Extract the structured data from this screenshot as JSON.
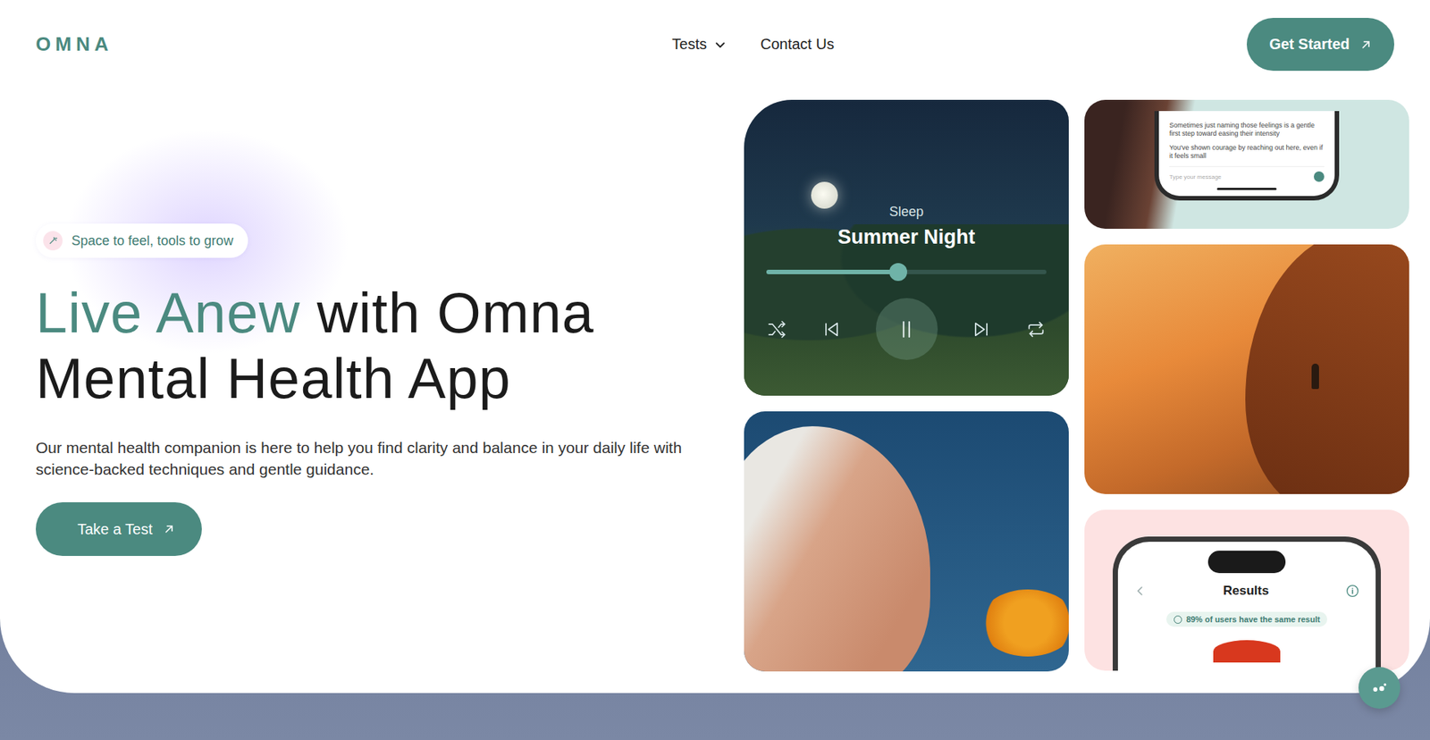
{
  "logo": "OMNA",
  "nav": [
    {
      "label": "Tests",
      "has_dropdown": true
    },
    {
      "label": "Contact Us",
      "has_dropdown": false
    }
  ],
  "cta": "Get Started",
  "hero": {
    "badge": "Space to feel, tools to grow",
    "title_accent": "Live Anew",
    "title_rest": "with Omna Mental Health App",
    "description": "Our mental health companion is here to help you find clarity and balance in your daily life with science-backed techniques and gentle guidance.",
    "button": "Take a Test"
  },
  "player": {
    "category": "Sleep",
    "track": "Summer Night",
    "level": 0.47,
    "playing": true
  },
  "chat_preview": {
    "messages": [
      "Sometimes just naming those feelings is a gentle first step toward easing their intensity",
      "You've shown courage by reaching out here, even if it feels small"
    ],
    "placeholder": "Type your message"
  },
  "results_preview": {
    "title": "Results",
    "badge": "89% of users have the same result"
  }
}
